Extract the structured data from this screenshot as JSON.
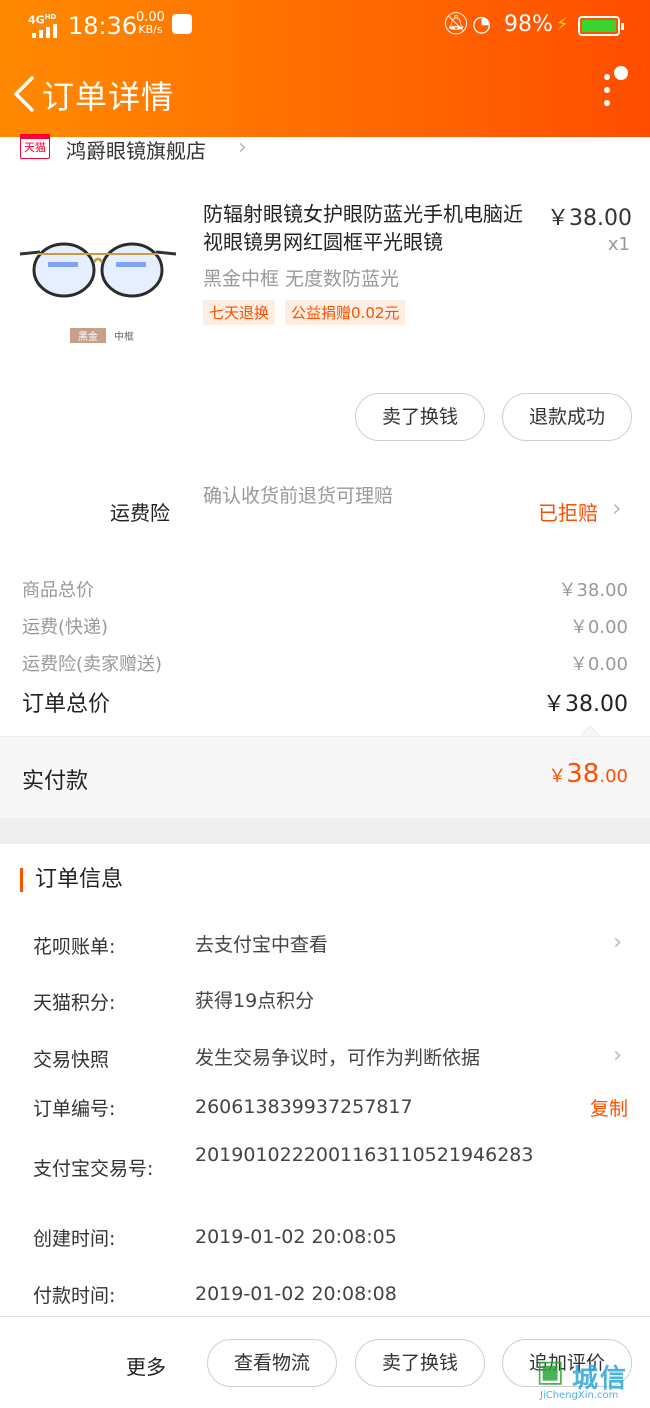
{
  "status_bar": {
    "network": "4G",
    "network_sup": "HD",
    "time": "18:36",
    "speed": "0.00",
    "speed_unit": "KB/s",
    "battery": "98%",
    "battery_color": "#38d430"
  },
  "header": {
    "title": "订单详情",
    "gradient": [
      "#ff8a00",
      "#ff4d00"
    ]
  },
  "shop": {
    "badge": "天猫",
    "name": "鸿爵眼镜旗舰店"
  },
  "product": {
    "title": "防辐射眼镜女护眼防蓝光手机电脑近视眼镜男网红圆框平光眼镜",
    "price": "￥38.00",
    "quantity": "x1",
    "spec": "黑金中框  无度数防蓝光",
    "image_tag_color": "黑金",
    "image_tag_frame": "中框",
    "tags": [
      "七天退换",
      "公益捐赠0.02元"
    ],
    "actions": [
      "卖了换钱",
      "退款成功"
    ]
  },
  "insurance": {
    "label": "运费险",
    "description": "确认收货前退货可理赔",
    "status": "已拒赔"
  },
  "price_summary": {
    "rows": [
      {
        "label": "商品总价",
        "value": "￥38.00"
      },
      {
        "label": "运费(快递)",
        "value": "￥0.00"
      },
      {
        "label": "运费险(卖家赠送)",
        "value": "￥0.00"
      }
    ],
    "total_label": "订单总价",
    "total_value": "￥38.00",
    "paid_label": "实付款",
    "paid_currency": "￥",
    "paid_int": "38",
    "paid_dec": ".00"
  },
  "order_info": {
    "heading": "订单信息",
    "rows": [
      {
        "label": "花呗账单:",
        "value": "去支付宝中查看"
      },
      {
        "label": "天猫积分:",
        "value": "获得19点积分"
      },
      {
        "label": "交易快照",
        "value": "发生交易争议时，可作为判断依据"
      },
      {
        "label": "订单编号:",
        "value": "260613839937257817",
        "action": "复制"
      },
      {
        "label": "支付宝交易号:",
        "value": "2019010222001163110521946283"
      },
      {
        "label": "创建时间:",
        "value": "2019-01-02 20:08:05"
      },
      {
        "label": "付款时间:",
        "value": "2019-01-02 20:08:08"
      }
    ]
  },
  "bottom_bar": {
    "more": "更多",
    "buttons": [
      "查看物流",
      "卖了换钱",
      "追加评价"
    ]
  },
  "watermark": {
    "text": "城信",
    "url": "JiChengXin.com"
  },
  "accent_color": "#ff5000"
}
